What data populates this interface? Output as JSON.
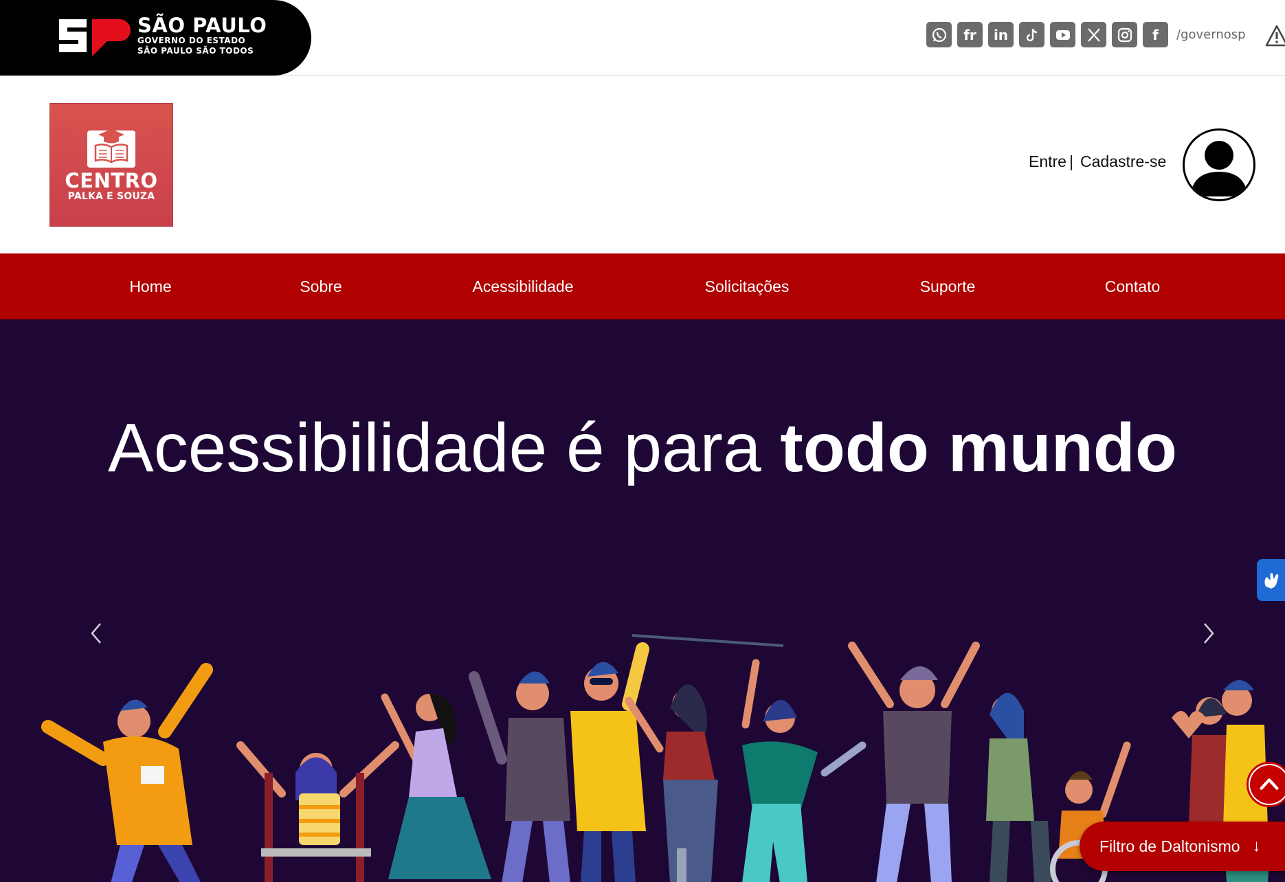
{
  "gov_bar": {
    "title": "SÃO PAULO",
    "subtitle": "GOVERNO DO ESTADO",
    "tagline": "SÃO PAULO SÃO TODOS",
    "social": [
      {
        "name": "whatsapp-icon",
        "glyph": ""
      },
      {
        "name": "flickr-icon",
        "glyph": "fr"
      },
      {
        "name": "linkedin-icon",
        "glyph": "in"
      },
      {
        "name": "tiktok-icon",
        "glyph": ""
      },
      {
        "name": "youtube-icon",
        "glyph": ""
      },
      {
        "name": "x-icon",
        "glyph": ""
      },
      {
        "name": "instagram-icon",
        "glyph": ""
      },
      {
        "name": "facebook-icon",
        "glyph": "f"
      }
    ],
    "handle": "/governosp"
  },
  "header": {
    "logo_line1": "CENTRO",
    "logo_line2": "PALKA E SOUZA",
    "login_label": "Entre",
    "separator": "|",
    "signup_label": "Cadastre-se"
  },
  "nav": {
    "items": [
      {
        "label": "Home"
      },
      {
        "label": "Sobre"
      },
      {
        "label": "Acessibilidade"
      },
      {
        "label": "Solicitações"
      },
      {
        "label": "Suporte"
      },
      {
        "label": "Contato"
      }
    ]
  },
  "hero": {
    "title_regular": "Acessibilidade é para ",
    "title_bold": "todo mundo"
  },
  "widgets": {
    "color_filter_label": "Filtro de Daltonismo",
    "color_filter_arrow": "↓"
  },
  "colors": {
    "nav_red": "#b00000",
    "hero_bg": "#1e0734",
    "logo_red": "#d9534f",
    "social_gray": "#6b6b6b"
  }
}
